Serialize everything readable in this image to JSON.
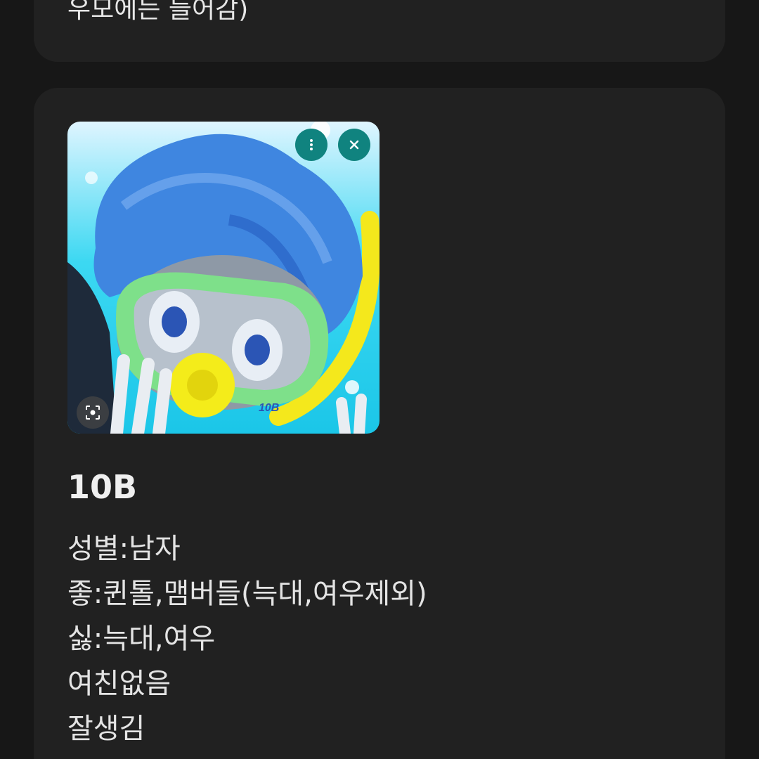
{
  "previous_card": {
    "text_fragment": "우모에는 들어감)"
  },
  "post": {
    "image": {
      "alt": "",
      "badge_text": "10B",
      "more_button_icon": "more-vert-icon",
      "close_button_icon": "close-icon",
      "lens_button_icon": "lens-scan-icon"
    },
    "title": "10B",
    "lines": [
      "성별:남자",
      "좋:퀸톨,맴버들(늑대,여우제외)",
      "싫:늑대,여우",
      "여친없음",
      "잘생김"
    ]
  },
  "colors": {
    "background": "#171717",
    "card": "#212121",
    "accent_button": "#10837f"
  }
}
